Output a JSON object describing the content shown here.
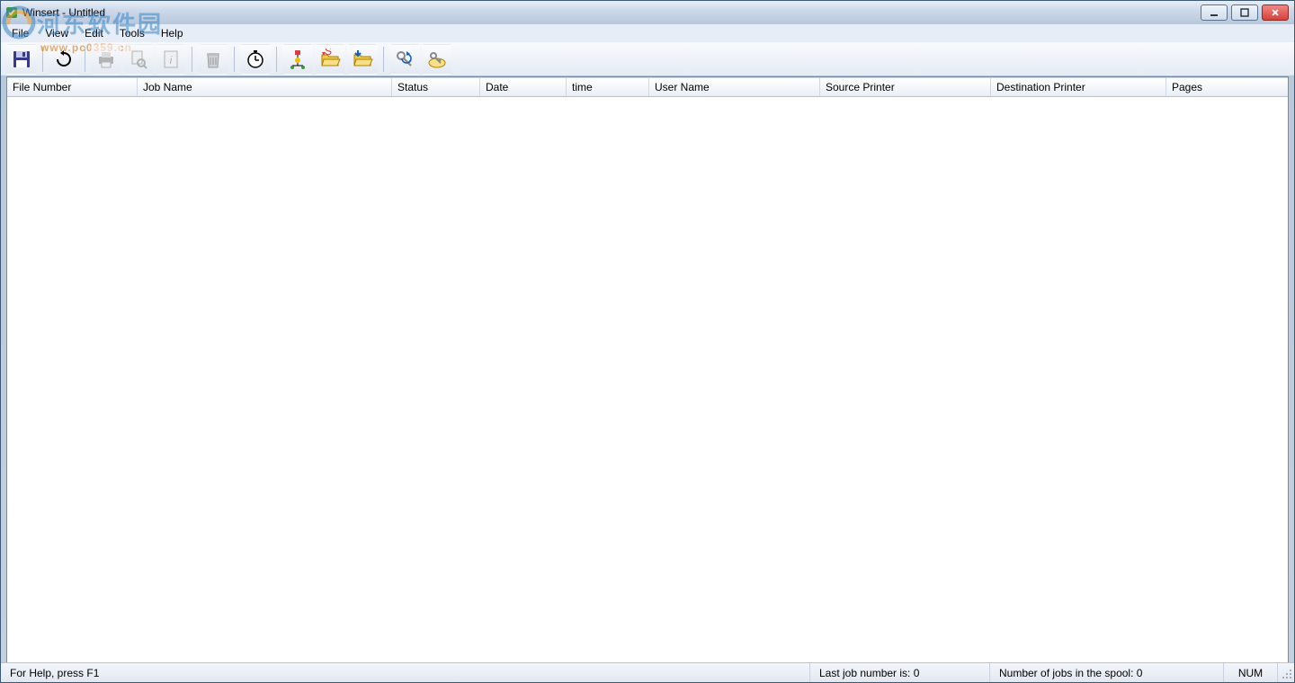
{
  "window": {
    "title": "Winsert - Untitled"
  },
  "menu": {
    "file": "File",
    "view": "View",
    "edit": "Edit",
    "tools": "Tools",
    "help": "Help"
  },
  "toolbar": {
    "save": "save-icon",
    "refresh": "refresh-icon",
    "print": "print-icon",
    "preview": "preview-icon",
    "info": "info-icon",
    "delete": "delete-icon",
    "timer": "timer-icon",
    "flow": "flow-icon",
    "open_folder": "open-folder-icon",
    "import_folder": "import-folder-icon",
    "key_refresh": "key-refresh-icon",
    "unlock": "unlock-icon"
  },
  "columns": {
    "file_number": "File Number",
    "job_name": "Job Name",
    "status": "Status",
    "date": "Date",
    "time": "time",
    "user_name": "User Name",
    "source_printer": "Source Printer",
    "destination_printer": "Destination Printer",
    "pages": "Pages"
  },
  "column_widths": {
    "file_number": 145,
    "job_name": 283,
    "status": 98,
    "date": 96,
    "time": 92,
    "user_name": 190,
    "source_printer": 190,
    "destination_printer": 195,
    "pages": 120
  },
  "status": {
    "help": "For Help, press F1",
    "last_job": "Last job number is: 0",
    "jobs_spool": "Number of jobs in the spool: 0",
    "num": "NUM"
  },
  "watermark": {
    "text": "河东软件园",
    "url": "www.pc0359.cn"
  }
}
